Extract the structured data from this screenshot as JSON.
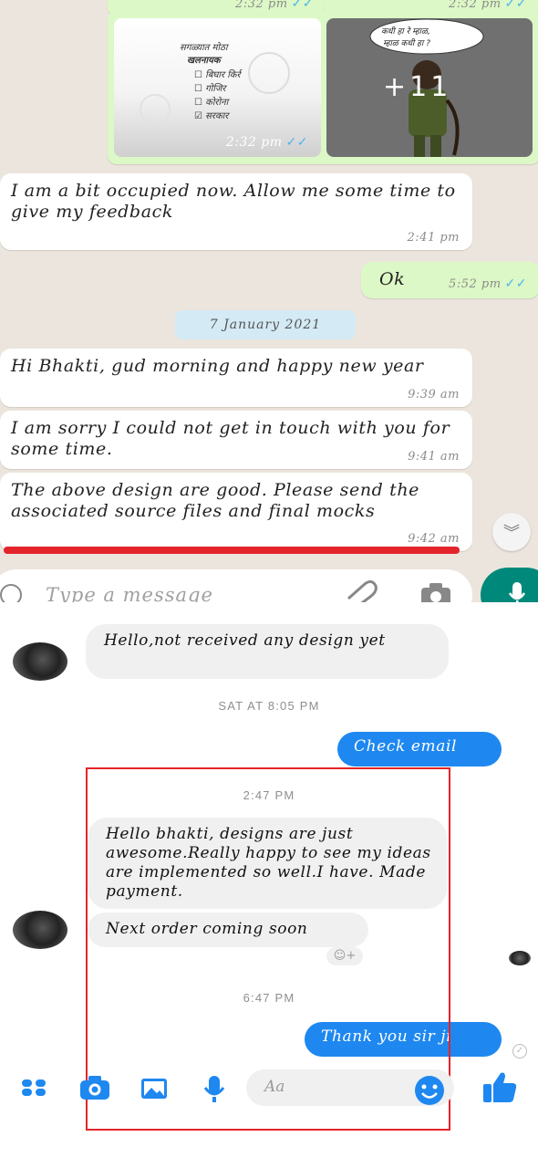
{
  "whatsapp": {
    "top_times": [
      "2:32 pm",
      "2:32 pm"
    ],
    "image_tiles": [
      {
        "time": "2:32 pm",
        "lines": [
          "सगळ्यात मोठा",
          "खलनायक",
          "☐ बिघार किर्र",
          "☐ गोजिर",
          "☐ कोरोना",
          "☑ सरकार"
        ]
      },
      {
        "overlay": "+11",
        "caption": [
          "कधी हा रे म्हाळ,",
          "म्हाळ कधी हा ?"
        ]
      }
    ],
    "messages_before_date": [
      {
        "text": "I am a bit occupied now. Allow me some time to give my feedback",
        "time": "2:41 pm",
        "direction": "in"
      },
      {
        "text": "Ok",
        "time": "5:52 pm",
        "direction": "out"
      }
    ],
    "date_chip": "7 January 2021",
    "messages_after_date": [
      {
        "text": "Hi Bhakti, gud morning and happy new year",
        "time": "9:39 am"
      },
      {
        "text": "I am sorry I could not get in touch with you for some time.",
        "time": "9:41 am"
      },
      {
        "text": "The above design are good. Please send the associated source files and final mocks",
        "time": "9:42 am"
      }
    ],
    "input_placeholder": "Type a message",
    "colors": {
      "incoming": "#ffffff",
      "outgoing": "#dcf8c6",
      "highlight": "#e3242b",
      "accent": "#00897b"
    }
  },
  "messenger": {
    "messages": {
      "first_incoming": "Hello,not received any design yet",
      "stamp_1": "SAT AT 8:05 PM",
      "outgoing_1": "Check email",
      "stamp_2": "2:47 PM",
      "incoming_long": "Hello bhakti, designs are just awesome.Really happy to see my ideas are implemented so well.I have. Made payment.",
      "incoming_short": "Next order coming soon",
      "stamp_3": "6:47 PM",
      "outgoing_2": "Thank you sir ji"
    },
    "composer_placeholder": "Aa",
    "toolbar_icons": [
      "apps-icon",
      "camera-icon",
      "gallery-icon",
      "mic-icon",
      "emoji-icon",
      "like-icon"
    ],
    "colors": {
      "accent": "#1e88f0",
      "incoming": "#f0f0f0",
      "highlight": "#e3242b"
    }
  }
}
